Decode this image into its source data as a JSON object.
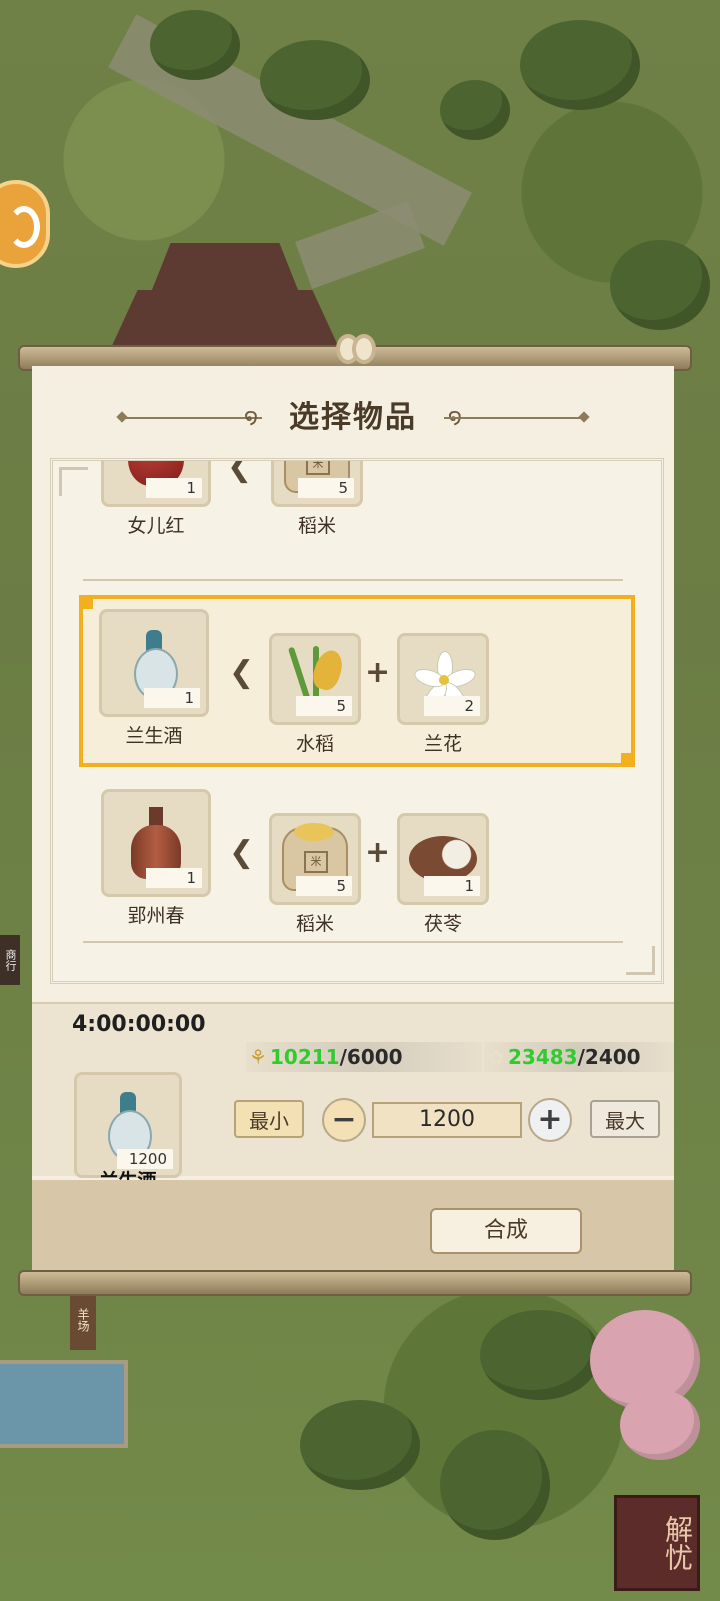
{
  "dialog": {
    "title": "选择物品"
  },
  "recipes": [
    {
      "output": {
        "name": "女儿红",
        "count": "1"
      },
      "ingredients": [
        {
          "name": "稻米",
          "count": "5"
        }
      ]
    },
    {
      "output": {
        "name": "兰生酒",
        "count": "1"
      },
      "ingredients": [
        {
          "name": "水稻",
          "count": "5"
        },
        {
          "name": "兰花",
          "count": "2"
        }
      ],
      "selected": true
    },
    {
      "output": {
        "name": "郢州春",
        "count": "1"
      },
      "ingredients": [
        {
          "name": "稻米",
          "count": "5"
        },
        {
          "name": "茯苓",
          "count": "1"
        }
      ]
    }
  ],
  "craft": {
    "timer": "4:00:00:00",
    "item": {
      "name": "兰生酒",
      "count": "1200"
    },
    "resources": [
      {
        "have": "10211",
        "need": "/6000",
        "icon": "rice-icon"
      },
      {
        "have": "23483",
        "need": "/2400",
        "icon": "orchid-icon"
      }
    ],
    "min_label": "最小",
    "max_label": "最大",
    "quantity": "1200",
    "synthesize_label": "合成"
  },
  "scene": {
    "shop_sign": "商行",
    "ranch_sign": "羊场",
    "corner_badge": "解忧"
  },
  "colors": {
    "highlight": "#f2b01e",
    "have_green": "#2ecc2e"
  }
}
